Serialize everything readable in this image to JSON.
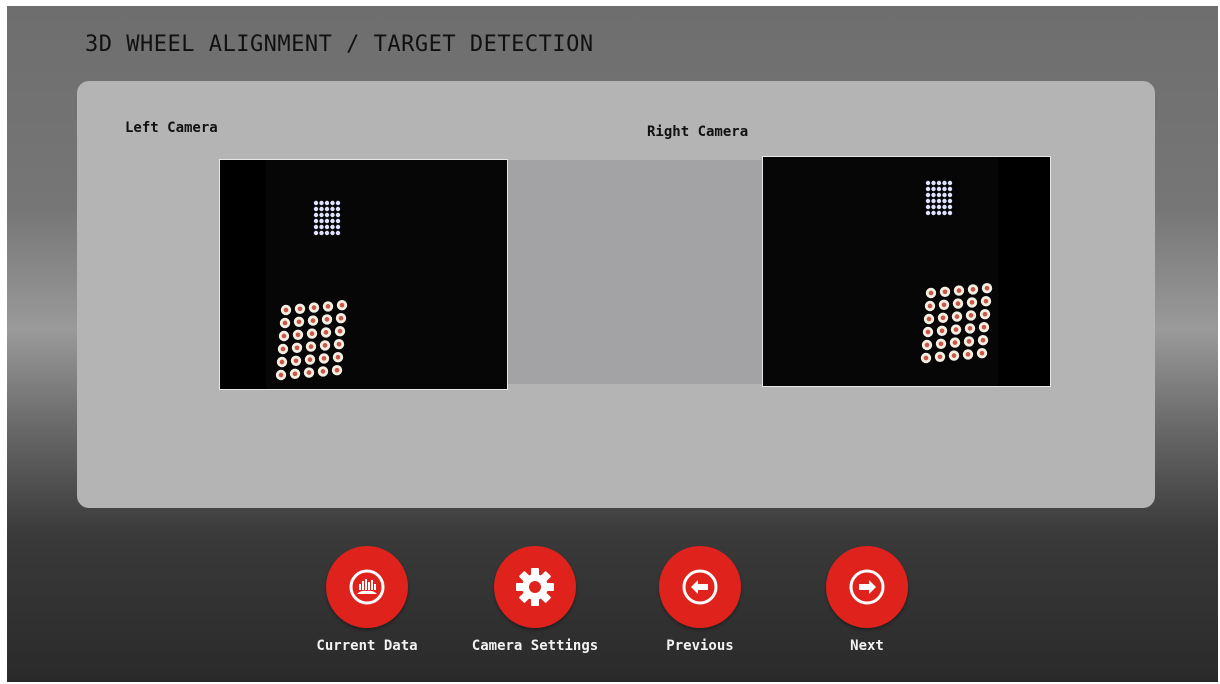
{
  "page": {
    "title": "3D WHEEL ALIGNMENT / TARGET DETECTION"
  },
  "cameras": {
    "left_label": "Left Camera",
    "right_label": "Right Camera"
  },
  "toolbar": {
    "buttons": [
      {
        "label": "Current Data",
        "icon": "chart-car-icon"
      },
      {
        "label": "Camera Settings",
        "icon": "gear-icon"
      },
      {
        "label": "Previous",
        "icon": "arrow-left-circle-icon"
      },
      {
        "label": "Next",
        "icon": "arrow-right-circle-icon"
      }
    ]
  },
  "colors": {
    "accent": "#e0221d",
    "panel": "#b4b4b5"
  }
}
